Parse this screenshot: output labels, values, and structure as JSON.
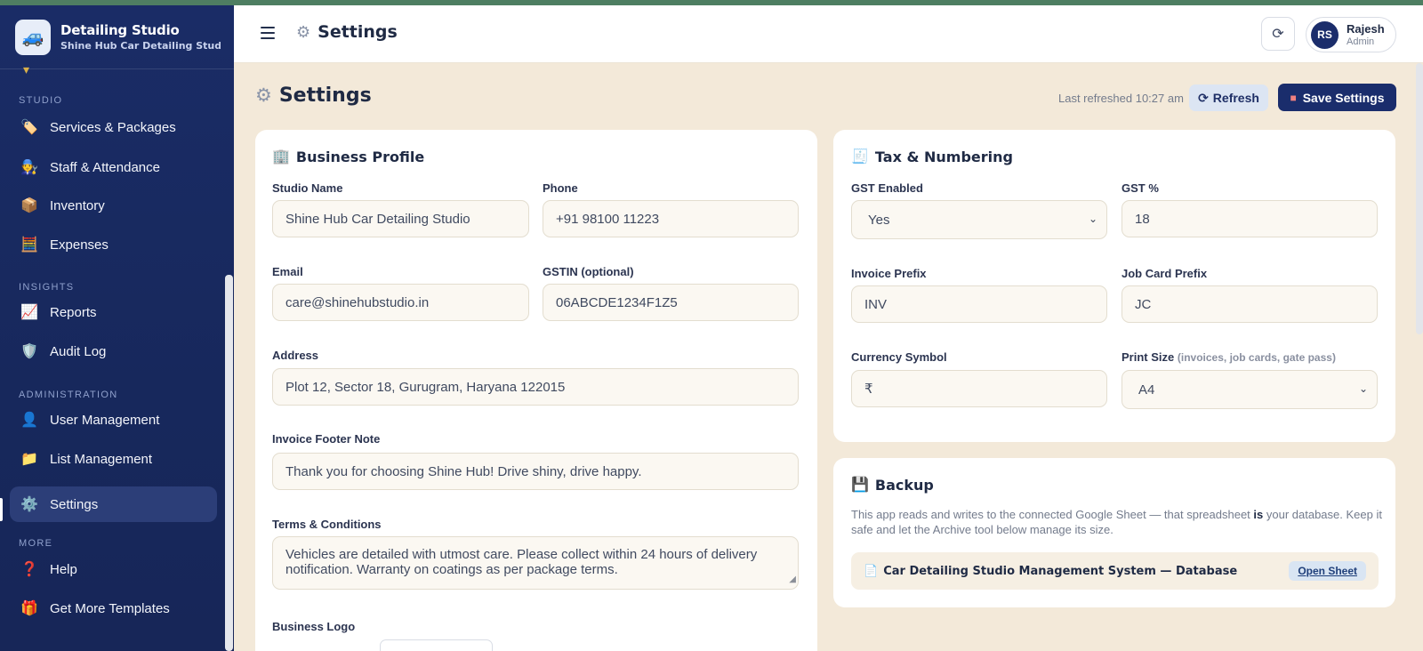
{
  "brand": {
    "title": "Detailing Studio",
    "subtitle": "Shine Hub Car Detailing Studio",
    "logo_icon": "car-icon"
  },
  "sidebar": {
    "sections": [
      {
        "label": "STUDIO"
      },
      {
        "label": "INSIGHTS"
      },
      {
        "label": "ADMINISTRATION"
      },
      {
        "label": "MORE"
      }
    ],
    "items": [
      {
        "label": "Services & Packages",
        "icon": "tag-icon"
      },
      {
        "label": "Staff & Attendance",
        "icon": "mechanic-icon"
      },
      {
        "label": "Inventory",
        "icon": "box-icon"
      },
      {
        "label": "Expenses",
        "icon": "abacus-icon"
      },
      {
        "label": "Reports",
        "icon": "chart-icon"
      },
      {
        "label": "Audit Log",
        "icon": "shield-icon"
      },
      {
        "label": "User Management",
        "icon": "user-icon"
      },
      {
        "label": "List Management",
        "icon": "folder-icon"
      },
      {
        "label": "Settings",
        "icon": "gear-icon",
        "active": true
      },
      {
        "label": "Help",
        "icon": "question-icon"
      },
      {
        "label": "Get More Templates",
        "icon": "gift-icon"
      }
    ]
  },
  "header": {
    "title": "Settings",
    "user": {
      "initials": "RS",
      "name": "Rajesh",
      "role": "Admin"
    }
  },
  "page": {
    "title": "Settings",
    "last_refreshed": "Last refreshed 10:27 am",
    "refresh_label": "Refresh",
    "save_label": "Save Settings"
  },
  "business_profile": {
    "title": "Business Profile",
    "studio_name_label": "Studio Name",
    "studio_name": "Shine Hub Car Detailing Studio",
    "phone_label": "Phone",
    "phone": "+91 98100 11223",
    "email_label": "Email",
    "email": "care@shinehubstudio.in",
    "gstin_label": "GSTIN (optional)",
    "gstin": "06ABCDE1234F1Z5",
    "address_label": "Address",
    "address": "Plot 12, Sector 18, Gurugram, Haryana 122015",
    "footer_note_label": "Invoice Footer Note",
    "footer_note": "Thank you for choosing Shine Hub! Drive shiny, drive happy.",
    "terms_label": "Terms & Conditions",
    "terms": "Vehicles are detailed with utmost care. Please collect within 24 hours of delivery notification. Warranty on coatings as per package terms.",
    "logo_label": "Business Logo"
  },
  "tax_numbering": {
    "title": "Tax & Numbering",
    "gst_enabled_label": "GST Enabled",
    "gst_enabled": "Yes",
    "gst_pct_label": "GST %",
    "gst_pct": "18",
    "invoice_prefix_label": "Invoice Prefix",
    "invoice_prefix": "INV",
    "job_card_prefix_label": "Job Card Prefix",
    "job_card_prefix": "JC",
    "currency_label": "Currency Symbol",
    "currency": "₹",
    "print_size_label": "Print Size",
    "print_size_hint": "(invoices, job cards, gate pass)",
    "print_size": "A4"
  },
  "backup": {
    "title": "Backup",
    "text_before": "This app reads and writes to the connected Google Sheet — that spreadsheet ",
    "text_bold": "is",
    "text_after": " your database. Keep it safe and let the Archive tool below manage its size.",
    "db_name": "Car Detailing Studio Management System — Database",
    "open_sheet": "Open Sheet"
  },
  "colors": {
    "sidebar_bg": "#1a2c66",
    "primary": "#1a2d6c",
    "page_bg": "#f3e9d9",
    "accent_stripe": "#4e7e62"
  }
}
